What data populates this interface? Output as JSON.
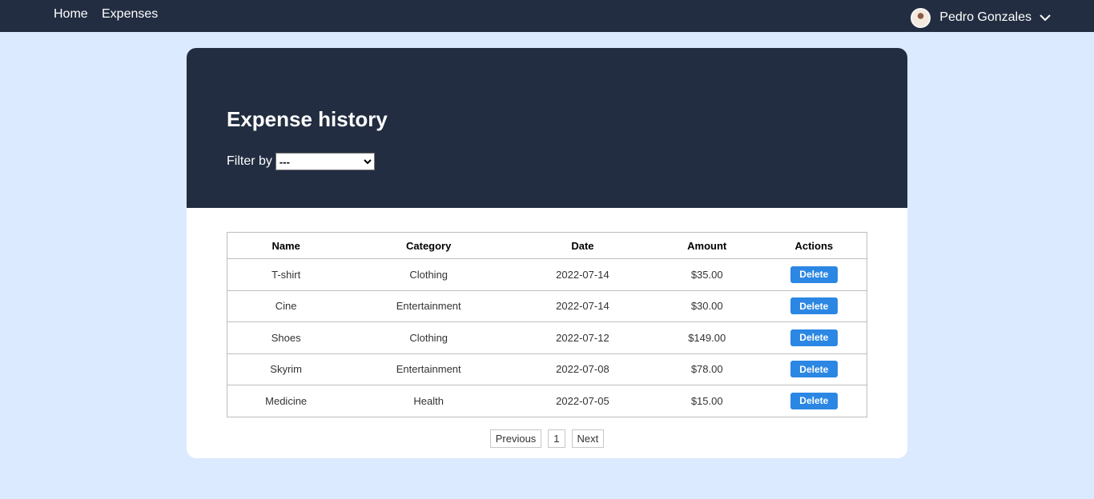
{
  "nav": {
    "links": [
      {
        "label": "Home"
      },
      {
        "label": "Expenses"
      }
    ],
    "user": {
      "name": "Pedro Gonzales"
    }
  },
  "header": {
    "title": "Expense history",
    "filter_label": "Filter by",
    "filter_selected": "---"
  },
  "table": {
    "columns": [
      "Name",
      "Category",
      "Date",
      "Amount",
      "Actions"
    ],
    "rows": [
      {
        "name": "T-shirt",
        "category": "Clothing",
        "date": "2022-07-14",
        "amount": "$35.00",
        "action": "Delete"
      },
      {
        "name": "Cine",
        "category": "Entertainment",
        "date": "2022-07-14",
        "amount": "$30.00",
        "action": "Delete"
      },
      {
        "name": "Shoes",
        "category": "Clothing",
        "date": "2022-07-12",
        "amount": "$149.00",
        "action": "Delete"
      },
      {
        "name": "Skyrim",
        "category": "Entertainment",
        "date": "2022-07-08",
        "amount": "$78.00",
        "action": "Delete"
      },
      {
        "name": "Medicine",
        "category": "Health",
        "date": "2022-07-05",
        "amount": "$15.00",
        "action": "Delete"
      }
    ]
  },
  "pagination": {
    "previous": "Previous",
    "page": "1",
    "next": "Next"
  },
  "colors": {
    "nav_bg": "#222d41",
    "page_bg": "#dbeafe",
    "accent": "#2b87e3"
  }
}
